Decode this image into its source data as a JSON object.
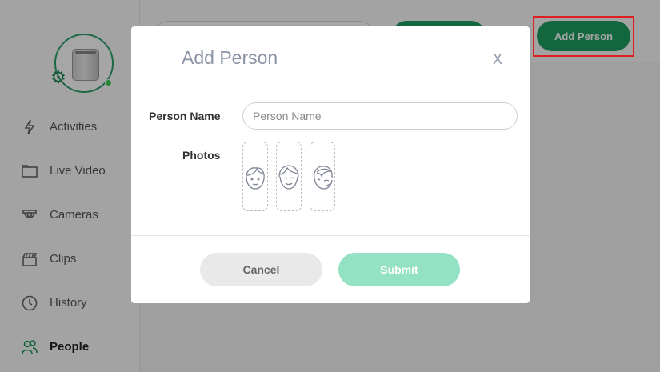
{
  "sidebar": {
    "items": [
      {
        "label": "Activities",
        "icon": "lightning-icon"
      },
      {
        "label": "Live Video",
        "icon": "video-folder-icon"
      },
      {
        "label": "Cameras",
        "icon": "camera-icon"
      },
      {
        "label": "Clips",
        "icon": "clapper-icon"
      },
      {
        "label": "History",
        "icon": "clock-icon"
      },
      {
        "label": "People",
        "icon": "people-icon",
        "active": true
      }
    ]
  },
  "header": {
    "add_person_label": "Add Person"
  },
  "modal": {
    "title": "Add Person",
    "close_label": "X",
    "person_name_label": "Person Name",
    "person_name_placeholder": "Person Name",
    "person_name_value": "",
    "photos_label": "Photos",
    "photo_slots": [
      "face-front-icon",
      "face-smile-icon",
      "face-side-icon"
    ],
    "cancel_label": "Cancel",
    "submit_label": "Submit"
  },
  "colors": {
    "accent": "#1d9f62",
    "accent_disabled": "#93e2c3",
    "highlight": "#e02020"
  }
}
